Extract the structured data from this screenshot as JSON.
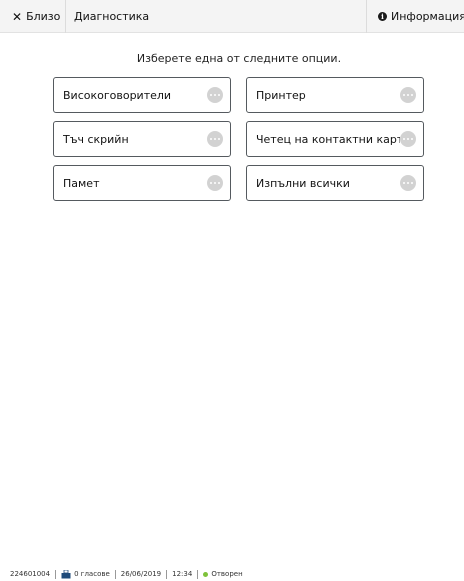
{
  "header": {
    "close_label": "Близо",
    "title": "Диагностика",
    "info_label": "Информация"
  },
  "main": {
    "prompt": "Изберете една от следните опции.",
    "options": [
      {
        "label": "Високоговорители",
        "icon": "more-icon"
      },
      {
        "label": "Принтер",
        "icon": "more-icon"
      },
      {
        "label": "Тъч скрийн",
        "icon": "more-icon"
      },
      {
        "label": "Четец на контактни карти*",
        "icon": "more-icon"
      },
      {
        "label": "Памет",
        "icon": "more-icon"
      },
      {
        "label": "Изпълни всички",
        "icon": "more-icon"
      }
    ]
  },
  "footer": {
    "device_id": "224601004",
    "votes": "0 гласове",
    "date": "26/06/2019",
    "time": "12:34",
    "status": "Отворен"
  },
  "colors": {
    "status_open": "#7ec23a",
    "border": "#555a5f",
    "ballot_box": "#1e4a7a"
  }
}
